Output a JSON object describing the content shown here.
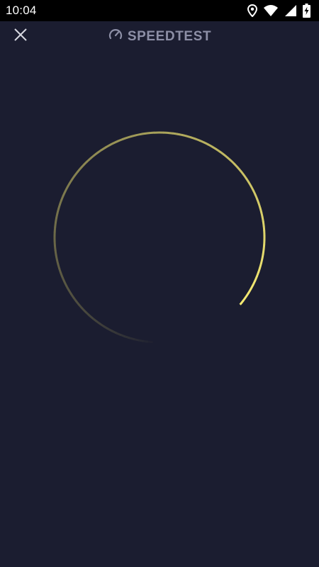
{
  "status_bar": {
    "time": "10:04",
    "icons": [
      "location-icon",
      "wifi-icon",
      "signal-icon",
      "battery-charging-icon"
    ]
  },
  "header": {
    "close_icon": "close-icon",
    "brand_icon": "speedometer-icon",
    "brand_text": "SPEEDTEST"
  },
  "test": {
    "ring_progress": 0.85,
    "ring_color": "#f5ea72"
  },
  "colors": {
    "background": "#1b1d30",
    "status_bar": "#000000",
    "brand": "#8d8fa6"
  }
}
